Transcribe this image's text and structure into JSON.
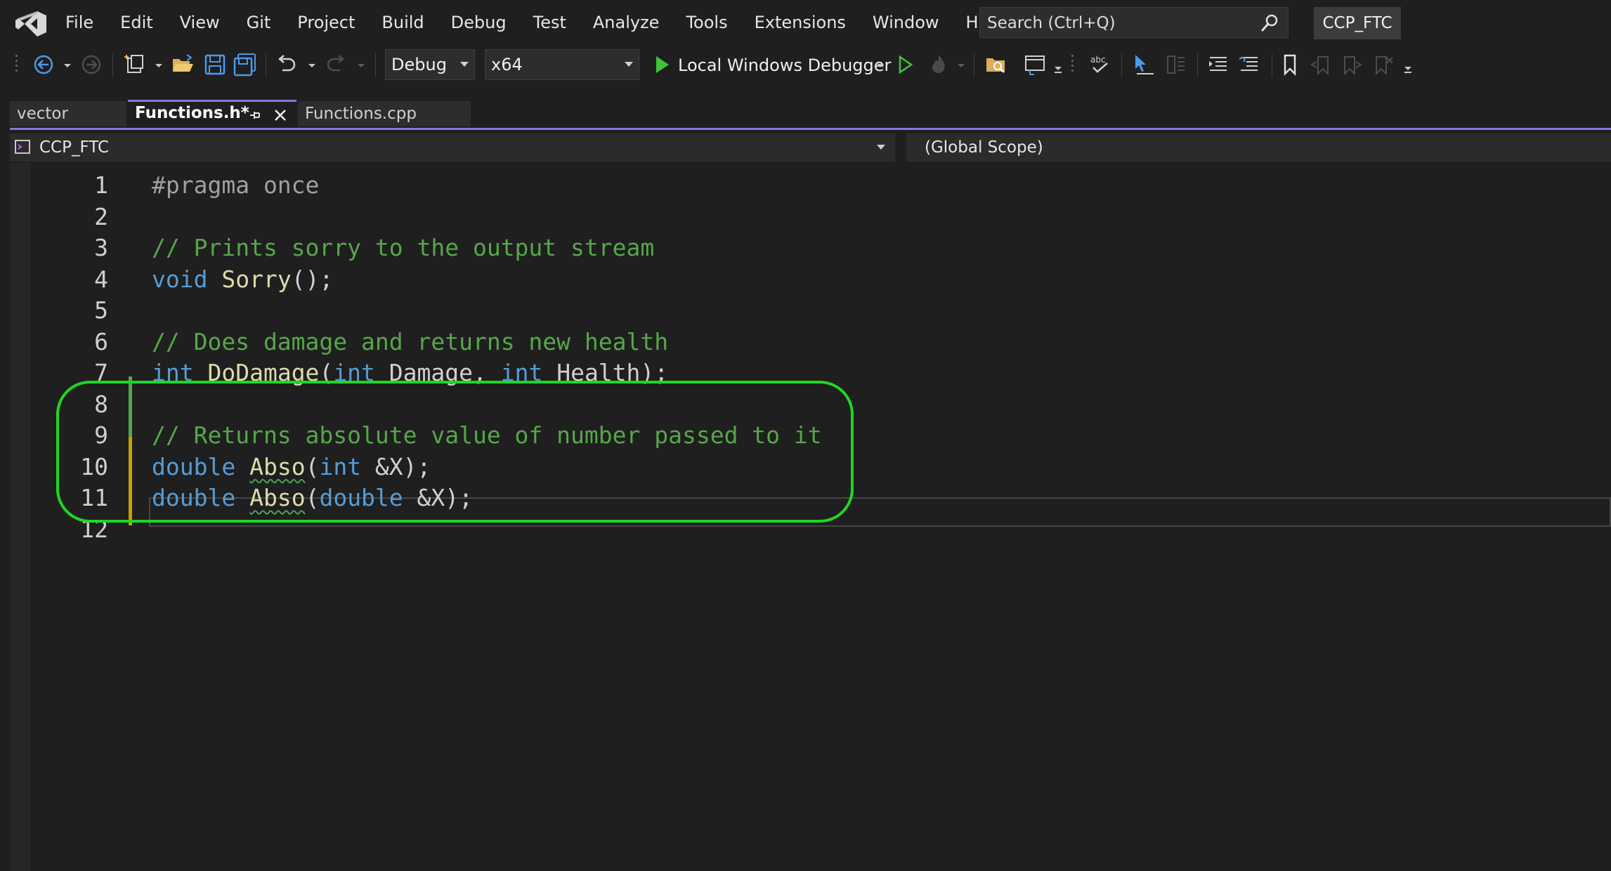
{
  "menubar": {
    "items": [
      "File",
      "Edit",
      "View",
      "Git",
      "Project",
      "Build",
      "Debug",
      "Test",
      "Analyze",
      "Tools",
      "Extensions",
      "Window",
      "Help"
    ],
    "search_placeholder": "Search (Ctrl+Q)",
    "solution_name": "CCP_FTC"
  },
  "toolbar": {
    "configuration": "Debug",
    "platform": "x64",
    "debugger": "Local Windows Debugger"
  },
  "tabs": [
    {
      "label": "vector",
      "active": false
    },
    {
      "label": "Functions.h*",
      "active": true
    },
    {
      "label": "Functions.cpp",
      "active": false
    }
  ],
  "navbar": {
    "project": "CCP_FTC",
    "scope": "(Global Scope)"
  },
  "editor": {
    "line_numbers": [
      "1",
      "2",
      "3",
      "4",
      "5",
      "6",
      "7",
      "8",
      "9",
      "10",
      "11",
      "12"
    ],
    "lines": [
      [
        {
          "t": "#pragma once",
          "c": "pre"
        }
      ],
      [],
      [
        {
          "t": "// Prints sorry to the output stream",
          "c": "com"
        }
      ],
      [
        {
          "t": "void",
          "c": "kw"
        },
        {
          "t": " ",
          "c": "plain"
        },
        {
          "t": "Sorry",
          "c": "fn"
        },
        {
          "t": "();",
          "c": "plain"
        }
      ],
      [],
      [
        {
          "t": "// Does damage and returns new health",
          "c": "com"
        }
      ],
      [
        {
          "t": "int",
          "c": "kw"
        },
        {
          "t": " ",
          "c": "plain"
        },
        {
          "t": "DoDamage",
          "c": "fn"
        },
        {
          "t": "(",
          "c": "plain"
        },
        {
          "t": "int",
          "c": "kw"
        },
        {
          "t": " Damage, ",
          "c": "plain"
        },
        {
          "t": "int",
          "c": "kw"
        },
        {
          "t": " Health);",
          "c": "plain"
        }
      ],
      [],
      [
        {
          "t": "// Returns absolute value of number passed to it",
          "c": "com"
        }
      ],
      [
        {
          "t": "double",
          "c": "kw"
        },
        {
          "t": " ",
          "c": "plain"
        },
        {
          "t": "Abso",
          "c": "fn",
          "squiggle": true
        },
        {
          "t": "(",
          "c": "plain"
        },
        {
          "t": "int",
          "c": "kw"
        },
        {
          "t": " &X);",
          "c": "plain"
        }
      ],
      [
        {
          "t": "double",
          "c": "kw"
        },
        {
          "t": " ",
          "c": "plain"
        },
        {
          "t": "Abso",
          "c": "fn",
          "squiggle": true
        },
        {
          "t": "(",
          "c": "plain"
        },
        {
          "t": "double",
          "c": "kw"
        },
        {
          "t": " &X);",
          "c": "plain"
        }
      ],
      []
    ]
  },
  "colors": {
    "accent": "#8c72dc",
    "highlight": "#1fd625",
    "comment": "#57a64a",
    "keyword": "#569cd6",
    "function": "#dcdcaa"
  }
}
